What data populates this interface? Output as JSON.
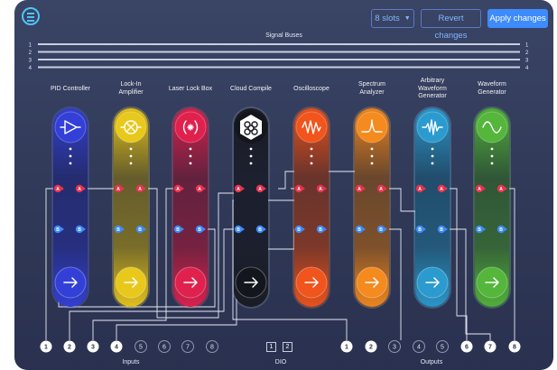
{
  "toolbar": {
    "slots_label": "8 slots",
    "revert_label": "Revert changes",
    "apply_label": "Apply changes",
    "accent_color": "#3d8bfd"
  },
  "signal_buses": {
    "title": "Signal Buses",
    "numbers": [
      "1",
      "2",
      "3",
      "4"
    ]
  },
  "instruments": [
    {
      "label": "PID Controller",
      "icon": "triangle-arrow-icon",
      "color": "#3340d8",
      "glow": "#6b7bff"
    },
    {
      "label": "Lock-In Amplifier",
      "icon": "circle-cross-icon",
      "color": "#e9c81c",
      "glow": "#ffe84d"
    },
    {
      "label": "Laser Lock Box",
      "icon": "laser-lock-icon",
      "color": "#e0214e",
      "glow": "#ff5a7f"
    },
    {
      "label": "Cloud Compile",
      "icon": "cloud-compile-icon",
      "color": "#1a1c24",
      "glow": "#9aa3b8"
    },
    {
      "label": "Oscilloscope",
      "icon": "oscilloscope-wave-icon",
      "color": "#f1541c",
      "glow": "#ff8a4d"
    },
    {
      "label": "Spectrum Analyzer",
      "icon": "spectrum-peak-icon",
      "color": "#f58a1e",
      "glow": "#ffb35c"
    },
    {
      "label": "Arbitrary Waveform Generator",
      "icon": "arbitrary-wave-icon",
      "color": "#2b9bcf",
      "glow": "#6fd2ff"
    },
    {
      "label": "Waveform Generator",
      "icon": "sine-wave-icon",
      "color": "#54b63b",
      "glow": "#8de36a"
    }
  ],
  "ports": {
    "a_label": "A",
    "b_label": "B"
  },
  "inputs": {
    "label": "Inputs",
    "numbers": [
      "1",
      "2",
      "3",
      "4",
      "5",
      "6",
      "7",
      "8"
    ]
  },
  "dio": {
    "label": "DIO",
    "numbers": [
      "1",
      "2"
    ]
  },
  "outputs": {
    "label": "Outputs",
    "numbers": [
      "1",
      "2",
      "3",
      "4",
      "5",
      "6",
      "7",
      "8"
    ]
  },
  "port_colors": {
    "a": "#e8334f",
    "b": "#3d8bfd"
  }
}
